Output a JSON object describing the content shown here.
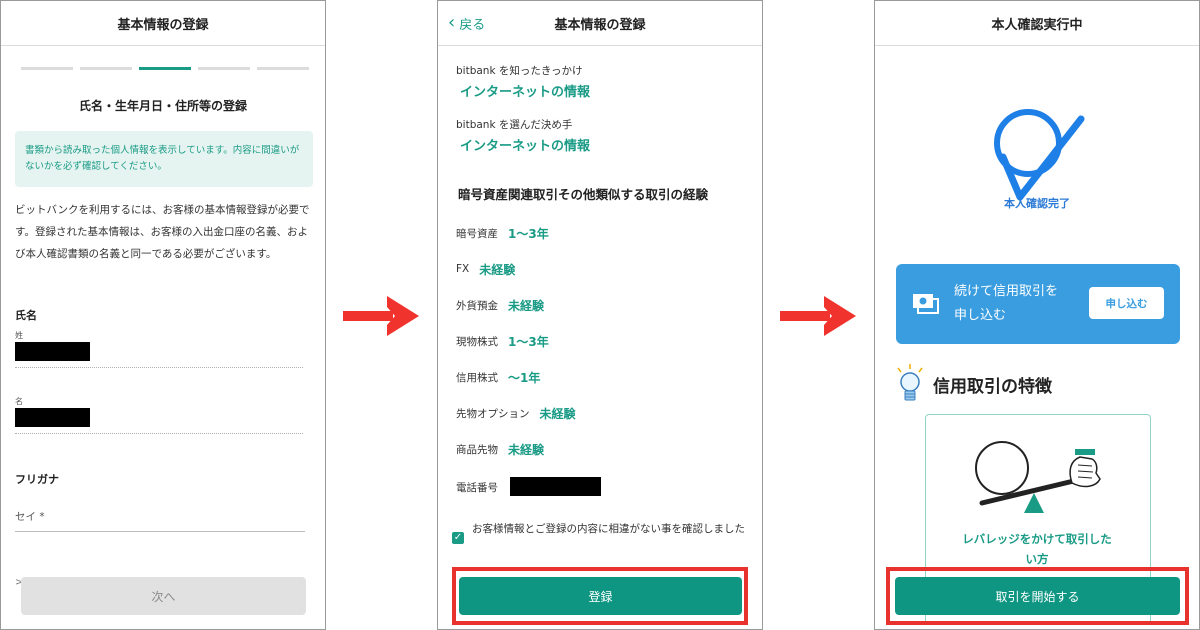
{
  "panel1": {
    "header": "基本情報の登録",
    "section_title": "氏名・生年月日・住所等の登録",
    "notice": "書類から読み取った個人情報を表示しています。内容に間違いがないかを必ず確認してください。",
    "intro": "ビットバンクを利用するには、お客様の基本情報登録が必要です。登録された基本情報は、お客様の入出金口座の名義、および本人確認書類の名義と同一である必要がございます。",
    "name_label": "氏名",
    "sei_label": "姓",
    "mei_label": "名",
    "furigana_label": "フリガナ",
    "sei_placeholder": "セイ *",
    "peek": ">",
    "next_button": "次へ"
  },
  "panel2": {
    "back_label": "戻る",
    "header": "基本情報の登録",
    "q1": "bitbank を知ったきっかけ",
    "a1": "インターネットの情報",
    "q2": "bitbank を選んだ決め手",
    "a2": "インターネットの情報",
    "experience_title": "暗号資産関連取引その他類似する取引の経験",
    "experience": [
      {
        "label": "暗号資産",
        "value": "1〜3年"
      },
      {
        "label": "FX",
        "value": "未経験"
      },
      {
        "label": "外貨預金",
        "value": "未経験"
      },
      {
        "label": "現物株式",
        "value": "1〜3年"
      },
      {
        "label": "信用株式",
        "value": "〜1年"
      },
      {
        "label": "先物オプション",
        "value": "未経験"
      },
      {
        "label": "商品先物",
        "value": "未経験"
      }
    ],
    "phone_label": "電話番号",
    "confirm_text": "お客様情報とご登録の内容に相違がない事を確認しました",
    "confirm_checked": true,
    "register_button": "登録"
  },
  "panel3": {
    "header": "本人確認実行中",
    "complete_text": "本人確認完了",
    "card_text_line1": "続けて信用取引を",
    "card_text_line2": "申し込む",
    "card_button": "申し込む",
    "feature_title": "信用取引の特徴",
    "leverage_line1": "レバレッジをかけて取引した",
    "leverage_line2": "い方",
    "start_button": "取引を開始する"
  },
  "colors": {
    "accent_green": "#1a9b86",
    "button_green": "#0f9682",
    "highlight_red": "#e8322d",
    "arrow_red": "#f0332c",
    "card_blue": "#3a9de0",
    "check_blue": "#1e7fe6"
  },
  "icons": {
    "back": "chevron-left-icon",
    "flow_arrow": "arrow-right-icon",
    "checkmark": "checkmark-icon",
    "money": "money-icon",
    "idea": "lightbulb-icon"
  }
}
